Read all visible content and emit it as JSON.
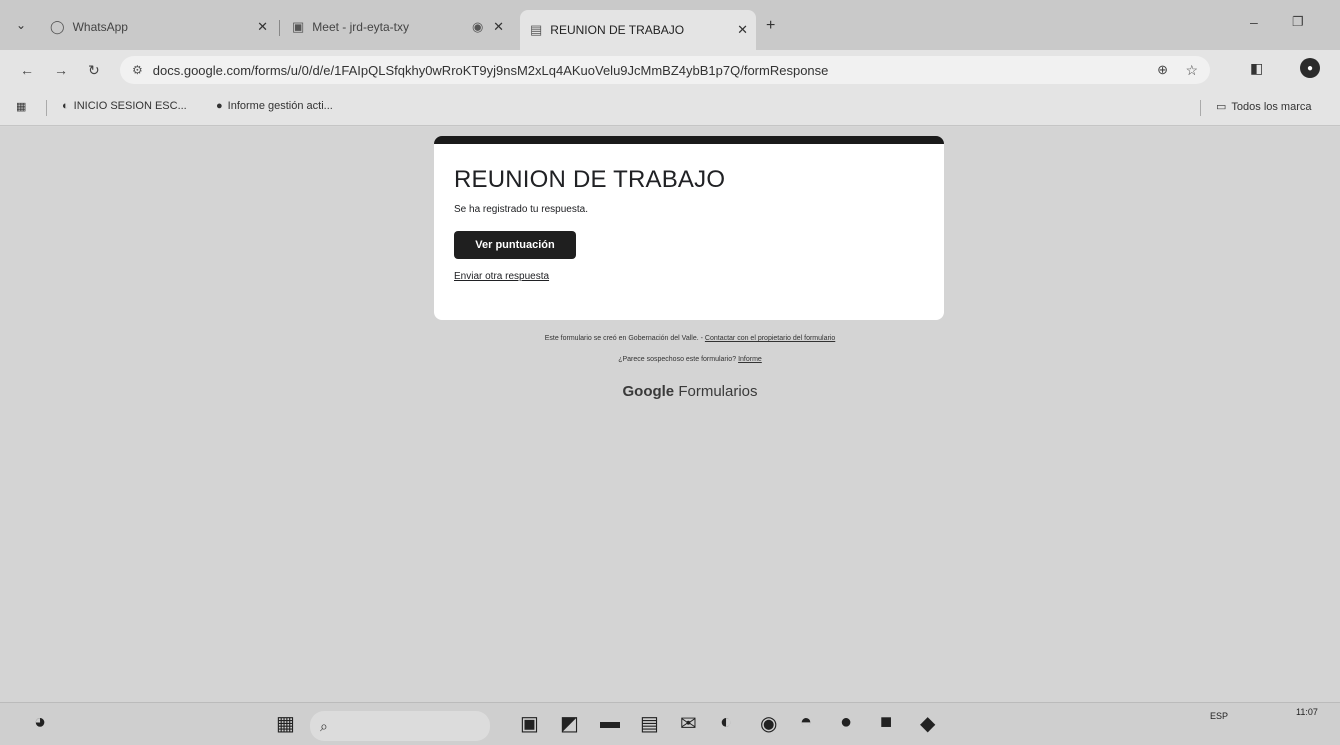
{
  "browser": {
    "tabs": [
      {
        "title": "WhatsApp",
        "icon": "whatsapp-icon"
      },
      {
        "title": "Meet - jrd-eyta-txy",
        "icon": "meet-icon"
      },
      {
        "title": "",
        "icon": "record-icon"
      },
      {
        "title": "REUNION DE TRABAJO",
        "icon": "forms-icon"
      }
    ],
    "url": "docs.google.com/forms/u/0/d/e/1FAIpQLSfqkhy0wRroKT9yj9nsM2xLq4AKuoVelu9JcMmBZ4ybB1p7Q/formResponse",
    "bookmarks": [
      {
        "label": "INICIO SESION ESC..."
      },
      {
        "label": "Informe gestión acti..."
      }
    ],
    "all_bookmarks": "Todos los marca"
  },
  "form": {
    "title": "REUNION DE TRABAJO",
    "message": "Se ha registrado tu respuesta.",
    "score_button": "Ver puntuación",
    "another_response": "Enviar otra respuesta"
  },
  "footer": {
    "created_text": "Este formulario se creó en Gobernación del Valle. -",
    "contact_link": "Contactar con el propietario del formulario",
    "suspicious_text": "¿Parece sospechoso este formulario?",
    "report_link": "Informe",
    "brand_google": "Google",
    "brand_forms": "Formularios"
  },
  "taskbar": {
    "language": "ESP",
    "time": "11:07"
  },
  "colors": {
    "page_bg": "#d4d4d4",
    "card_accent": "#1a1a1a",
    "button_bg": "#1f1f1f"
  }
}
